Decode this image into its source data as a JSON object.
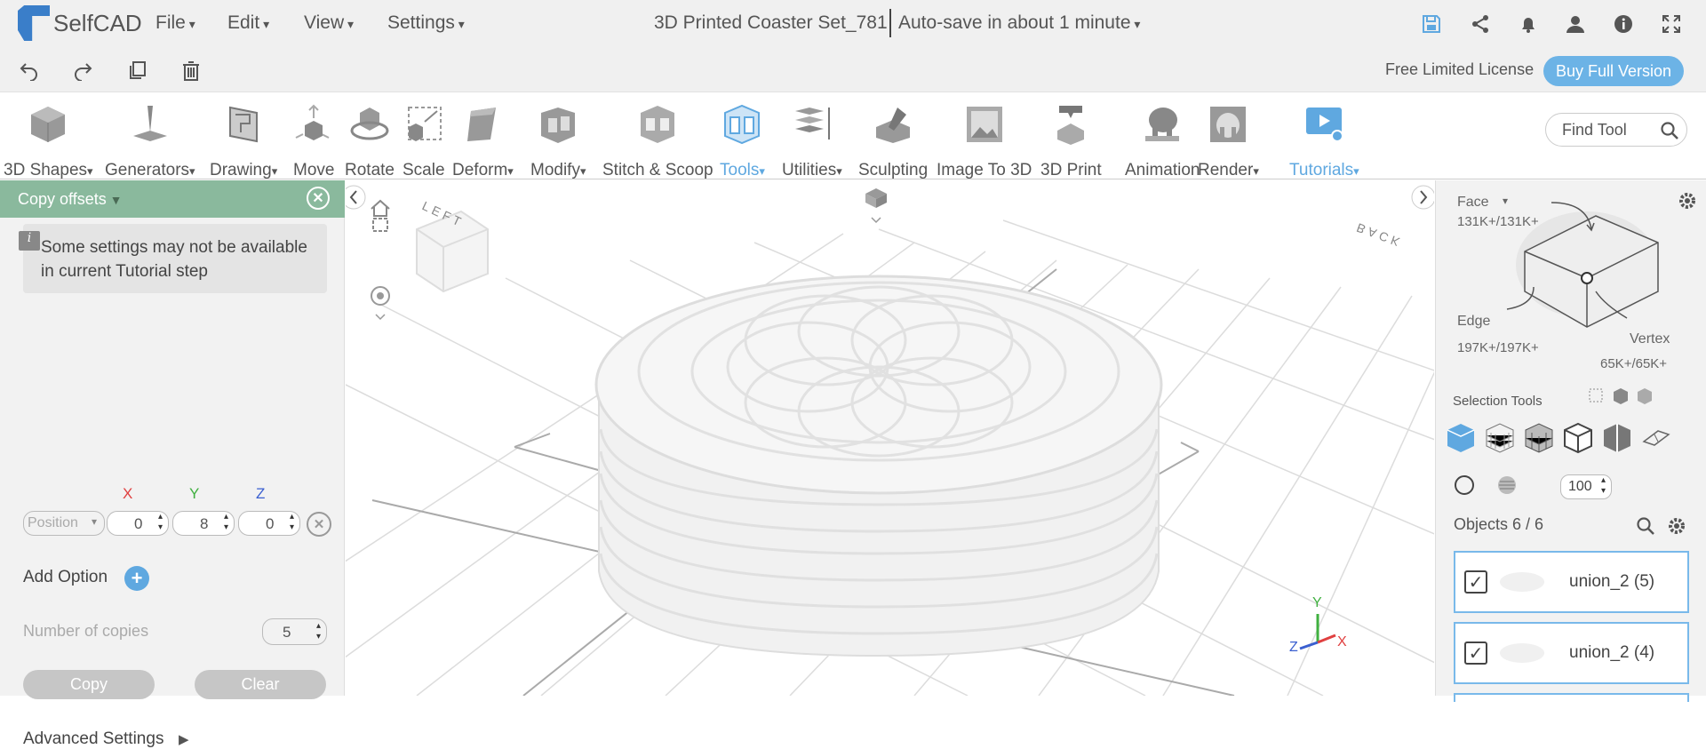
{
  "app": {
    "name": "SelfCAD"
  },
  "menus": [
    "File",
    "Edit",
    "View",
    "Settings"
  ],
  "document": {
    "title": "3D Printed Coaster Set_781",
    "autosave": "Auto-save in about 1 minute"
  },
  "topicons": [
    "save-icon",
    "share-icon",
    "bell-icon",
    "user-icon",
    "info-icon",
    "fullscreen-icon"
  ],
  "secondary": {
    "license": "Free Limited License",
    "buy": "Buy Full Version"
  },
  "tools": [
    {
      "label": "3D Shapes"
    },
    {
      "label": "Generators"
    },
    {
      "label": "Drawing"
    },
    {
      "label": "Move"
    },
    {
      "label": "Rotate"
    },
    {
      "label": "Scale"
    },
    {
      "label": "Deform"
    },
    {
      "label": "Modify"
    },
    {
      "label": "Stitch & Scoop"
    },
    {
      "label": "Tools"
    },
    {
      "label": "Utilities"
    },
    {
      "label": "Sculpting"
    },
    {
      "label": "Image To 3D"
    },
    {
      "label": "3D Print"
    },
    {
      "label": "Animation"
    },
    {
      "label": "Render"
    },
    {
      "label": "Tutorials"
    }
  ],
  "find_tool": {
    "placeholder": "Find Tool"
  },
  "left_panel": {
    "title": "Copy offsets",
    "info": "Some settings may not be available in current Tutorial step",
    "axes": [
      "X",
      "Y",
      "Z"
    ],
    "mode": "Position",
    "values": {
      "x": "0",
      "y": "8",
      "z": "0"
    },
    "add_option": "Add Option",
    "copies_label": "Number of copies",
    "copies_value": "5",
    "copy_btn": "Copy",
    "clear_btn": "Clear",
    "advanced": "Advanced Settings"
  },
  "viewport": {
    "cube_labels": [
      "LEFT",
      "BACK"
    ],
    "axis": [
      "Y",
      "Z",
      "X"
    ],
    "colors": {
      "x": "#e04040",
      "y": "#40b040",
      "z": "#3a5fd0"
    }
  },
  "right_panel": {
    "face_label": "Face",
    "face_count": "131K+/131K+",
    "edge_label": "Edge",
    "edge_count": "197K+/197K+",
    "vertex_label": "Vertex",
    "vertex_count": "65K+/65K+",
    "selection_tools": "Selection Tools",
    "brush_size": "100",
    "objects_label": "Objects 6 / 6",
    "objects": [
      {
        "name": "union_2 (5)"
      },
      {
        "name": "union_2 (4)"
      }
    ]
  }
}
